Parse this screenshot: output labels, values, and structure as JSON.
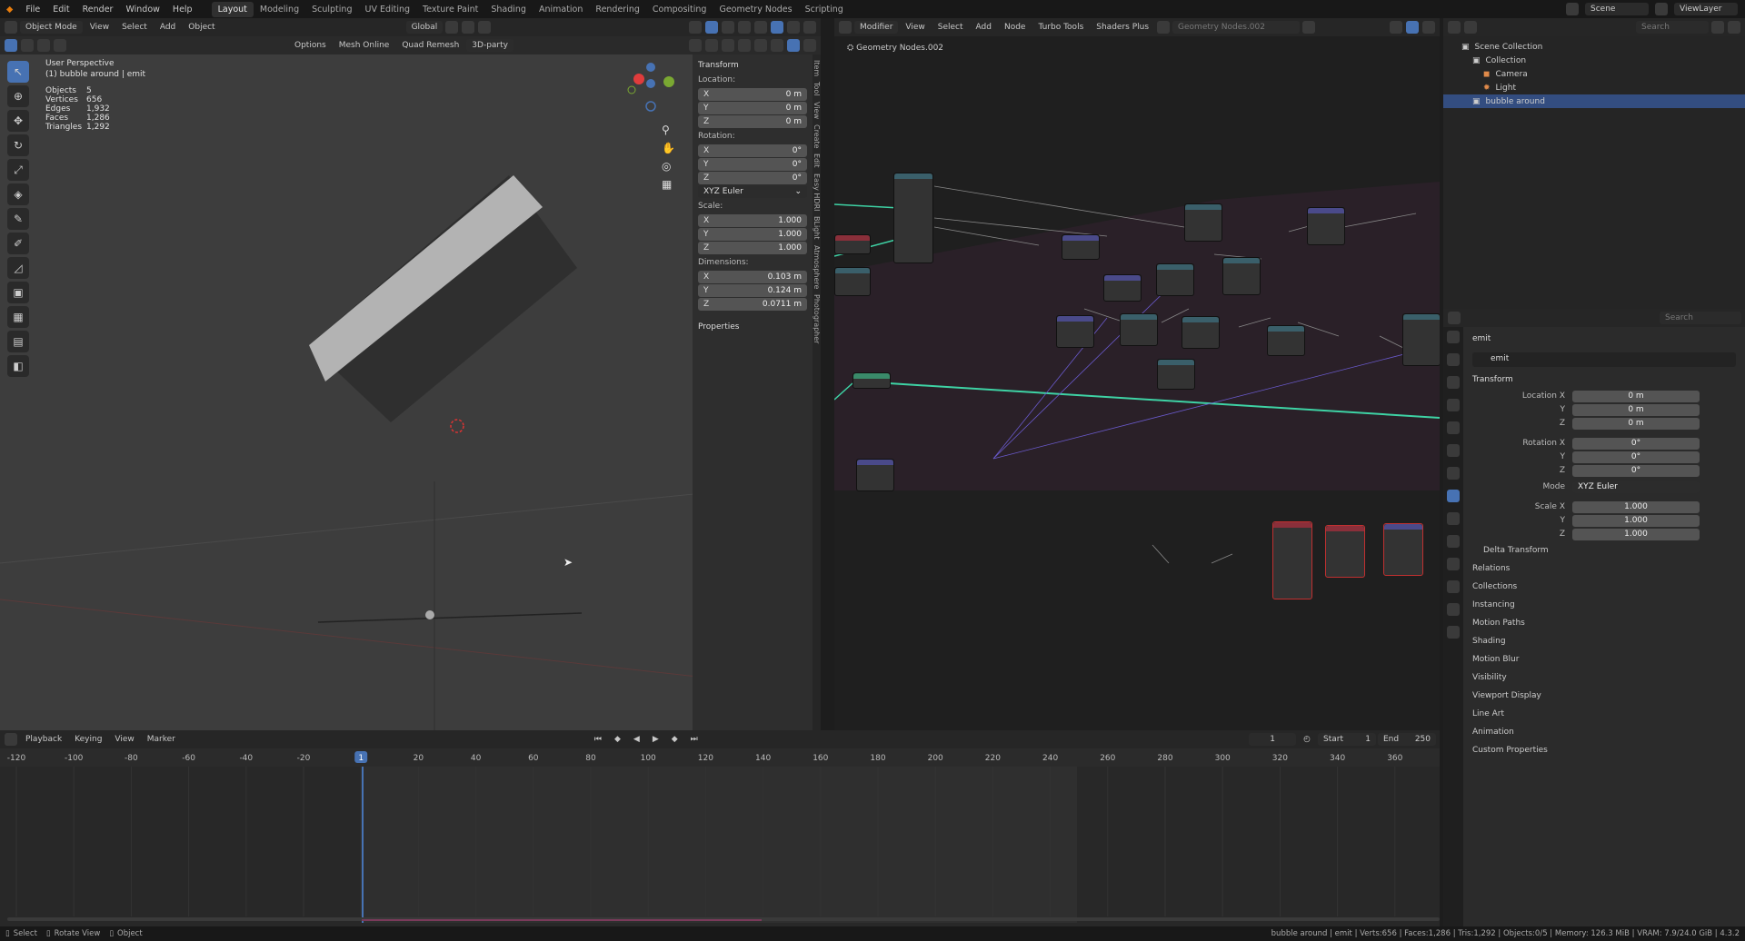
{
  "menu": [
    "File",
    "Edit",
    "Render",
    "Window",
    "Help"
  ],
  "workspaces": [
    "Layout",
    "Modeling",
    "Sculpting",
    "UV Editing",
    "Texture Paint",
    "Shading",
    "Animation",
    "Rendering",
    "Compositing",
    "Geometry Nodes",
    "Scripting"
  ],
  "active_workspace": "Layout",
  "scene": "Scene",
  "view_layer": "ViewLayer",
  "viewport": {
    "mode": "Object Mode",
    "menus": [
      "View",
      "Select",
      "Add",
      "Object"
    ],
    "orientation": "Global",
    "options_label": "Options",
    "addons": [
      "Mesh Online",
      "Quad Remesh",
      "3D-party"
    ],
    "perspective_label": "User Perspective",
    "object_label": "(1) bubble around | emit",
    "stats": [
      {
        "label": "Objects",
        "value": "5"
      },
      {
        "label": "Vertices",
        "value": "656"
      },
      {
        "label": "Edges",
        "value": "1,932"
      },
      {
        "label": "Faces",
        "value": "1,286"
      },
      {
        "label": "Triangles",
        "value": "1,292"
      }
    ]
  },
  "npanel": {
    "section": "Transform",
    "location_label": "Location:",
    "location": [
      {
        "axis": "X",
        "value": "0 m"
      },
      {
        "axis": "Y",
        "value": "0 m"
      },
      {
        "axis": "Z",
        "value": "0 m"
      }
    ],
    "rotation_label": "Rotation:",
    "rotation": [
      {
        "axis": "X",
        "value": "0°"
      },
      {
        "axis": "Y",
        "value": "0°"
      },
      {
        "axis": "Z",
        "value": "0°"
      }
    ],
    "rotation_mode": "XYZ Euler",
    "scale_label": "Scale:",
    "scale": [
      {
        "axis": "X",
        "value": "1.000"
      },
      {
        "axis": "Y",
        "value": "1.000"
      },
      {
        "axis": "Z",
        "value": "1.000"
      }
    ],
    "dimensions_label": "Dimensions:",
    "dimensions": [
      {
        "axis": "X",
        "value": "0.103 m"
      },
      {
        "axis": "Y",
        "value": "0.124 m"
      },
      {
        "axis": "Z",
        "value": "0.0711 m"
      }
    ],
    "properties_label": "Properties",
    "tabs": [
      "Item",
      "Tool",
      "View",
      "Create",
      "Edit",
      "Easy HDRI",
      "BLight",
      "Atmosphere",
      "Photographer"
    ]
  },
  "node_editor": {
    "editor_type": "Modifier",
    "menus": [
      "View",
      "Select",
      "Add",
      "Node",
      "Turbo Tools",
      "Shaders Plus"
    ],
    "tree_name": "Geometry Nodes.002",
    "breadcrumb": "Geometry Nodes.002"
  },
  "outliner": {
    "search_placeholder": "Search",
    "rows": [
      {
        "label": "Scene Collection",
        "indent": 0,
        "selected": false
      },
      {
        "label": "Collection",
        "indent": 1,
        "selected": false
      },
      {
        "label": "Camera",
        "indent": 2,
        "selected": false
      },
      {
        "label": "Light",
        "indent": 2,
        "selected": false
      },
      {
        "label": "bubble around",
        "indent": 1,
        "selected": true
      }
    ]
  },
  "properties": {
    "search_placeholder": "Search",
    "object_name": "emit",
    "data_name": "emit",
    "transform_label": "Transform",
    "fields": [
      {
        "label": "Location X",
        "value": "0 m"
      },
      {
        "label": "Y",
        "value": "0 m"
      },
      {
        "label": "Z",
        "value": "0 m"
      },
      {
        "label": "Rotation X",
        "value": "0°"
      },
      {
        "label": "Y",
        "value": "0°"
      },
      {
        "label": "Z",
        "value": "0°"
      },
      {
        "label": "Mode",
        "value": "XYZ Euler"
      },
      {
        "label": "Scale X",
        "value": "1.000"
      },
      {
        "label": "Y",
        "value": "1.000"
      },
      {
        "label": "Z",
        "value": "1.000"
      }
    ],
    "sections": [
      "Delta Transform",
      "Relations",
      "Collections",
      "Instancing",
      "Motion Paths",
      "Shading",
      "Motion Blur",
      "Visibility",
      "Viewport Display",
      "Line Art",
      "Animation",
      "Custom Properties"
    ]
  },
  "timeline": {
    "menus": [
      "Playback",
      "Keying",
      "View",
      "Marker"
    ],
    "current_frame": "1",
    "start_label": "Start",
    "start": "1",
    "end_label": "End",
    "end": "250",
    "ruler": [
      "-120",
      "-100",
      "-80",
      "-60",
      "-40",
      "-20",
      "1",
      "20",
      "40",
      "60",
      "80",
      "100",
      "120",
      "140",
      "160",
      "180",
      "200",
      "220",
      "240",
      "260",
      "280",
      "300",
      "320",
      "340",
      "360"
    ]
  },
  "statusbar": {
    "left": [
      "Select",
      "Rotate View",
      "Object"
    ],
    "right": "bubble around | emit | Verts:656 | Faces:1,286 | Tris:1,292 | Objects:0/5 | Memory: 126.3 MiB | VRAM: 7.9/24.0 GiB | 4.3.2"
  }
}
